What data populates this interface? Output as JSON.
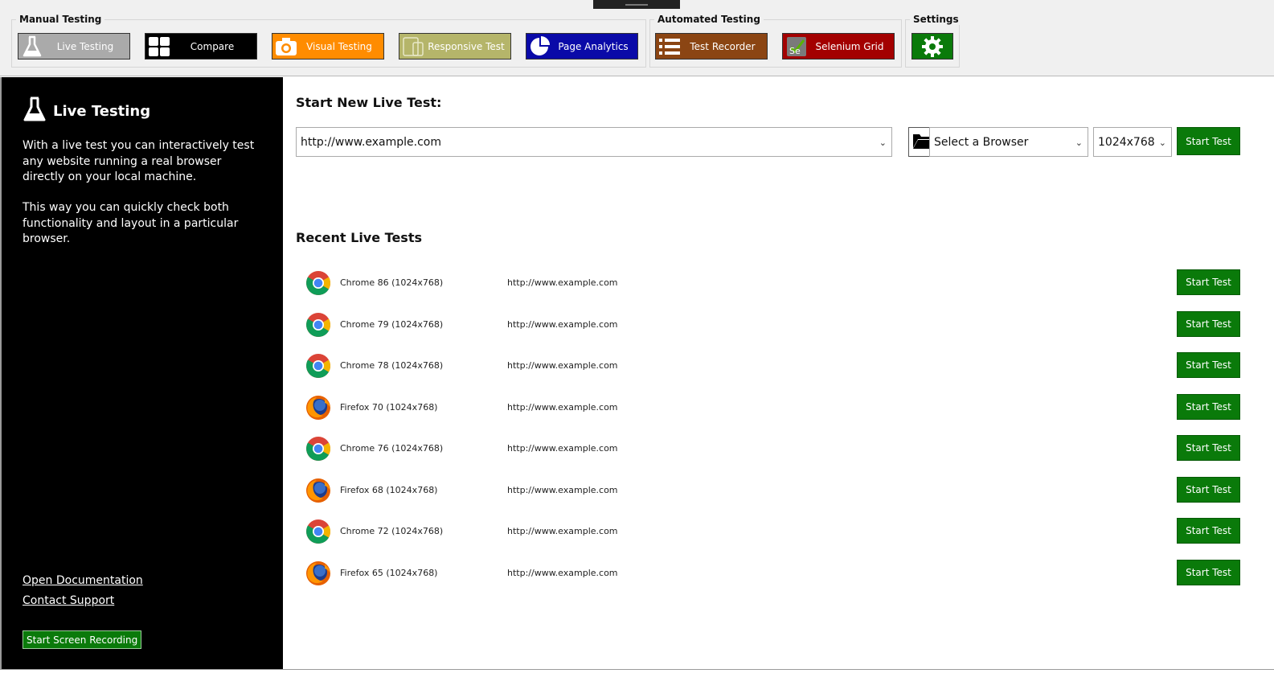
{
  "ribbon": {
    "groups": {
      "manual": "Manual Testing",
      "automated": "Automated Testing",
      "settings": "Settings"
    },
    "buttons": [
      {
        "label": "Live Testing",
        "icon": "flask-icon",
        "bg": "#aaaaaa",
        "color": "#ffffff"
      },
      {
        "label": "Compare",
        "icon": "grid-icon",
        "bg": "#000000",
        "color": "#ffffff"
      },
      {
        "label": "Visual Testing",
        "icon": "camera-icon",
        "bg": "#ff8c00",
        "color": "#ffffff"
      },
      {
        "label": "Responsive Test",
        "icon": "devices-icon",
        "bg": "#b5b56a",
        "color": "#ffffff"
      },
      {
        "label": "Page Analytics",
        "icon": "pie-chart-icon",
        "bg": "#0a0aa8",
        "color": "#ffffff"
      },
      {
        "label": "Test Recorder",
        "icon": "list-icon",
        "bg": "#8b4513",
        "color": "#ffffff"
      },
      {
        "label": "Selenium Grid",
        "icon": "selenium-icon",
        "bg": "#a30000",
        "color": "#ffffff"
      }
    ],
    "settings_icon": "gear-icon"
  },
  "sidebar": {
    "title": "Live Testing",
    "para1": "With a live test you can interactively test any website running a real browser directly on your local machine.",
    "para2": "This way you can quickly check both functionality and layout in a particular browser.",
    "links": {
      "docs": "Open Documentation",
      "support": "Contact Support"
    },
    "record_button": "Start Screen Recording"
  },
  "main": {
    "new_test_heading": "Start New Live Test:",
    "url_value": "http://www.example.com",
    "browser_select": "Select a Browser",
    "resolution_select": "1024x768",
    "start_button": "Start Test",
    "recent_heading": "Recent Live Tests",
    "recent": [
      {
        "browser": "Chrome 86 (1024x768)",
        "type": "chrome",
        "url": "http://www.example.com",
        "button": "Start Test"
      },
      {
        "browser": "Chrome 79 (1024x768)",
        "type": "chrome",
        "url": "http://www.example.com",
        "button": "Start Test"
      },
      {
        "browser": "Chrome 78 (1024x768)",
        "type": "chrome",
        "url": "http://www.example.com",
        "button": "Start Test"
      },
      {
        "browser": "Firefox 70 (1024x768)",
        "type": "firefox",
        "url": "http://www.example.com",
        "button": "Start Test"
      },
      {
        "browser": "Chrome 76 (1024x768)",
        "type": "chrome",
        "url": "http://www.example.com",
        "button": "Start Test"
      },
      {
        "browser": "Firefox 68 (1024x768)",
        "type": "firefox",
        "url": "http://www.example.com",
        "button": "Start Test"
      },
      {
        "browser": "Chrome 72 (1024x768)",
        "type": "chrome",
        "url": "http://www.example.com",
        "button": "Start Test"
      },
      {
        "browser": "Firefox 65 (1024x768)",
        "type": "firefox",
        "url": "http://www.example.com",
        "button": "Start Test"
      }
    ]
  },
  "colors": {
    "accent_green": "#0a7a0a",
    "sidebar_bg": "#000000"
  }
}
